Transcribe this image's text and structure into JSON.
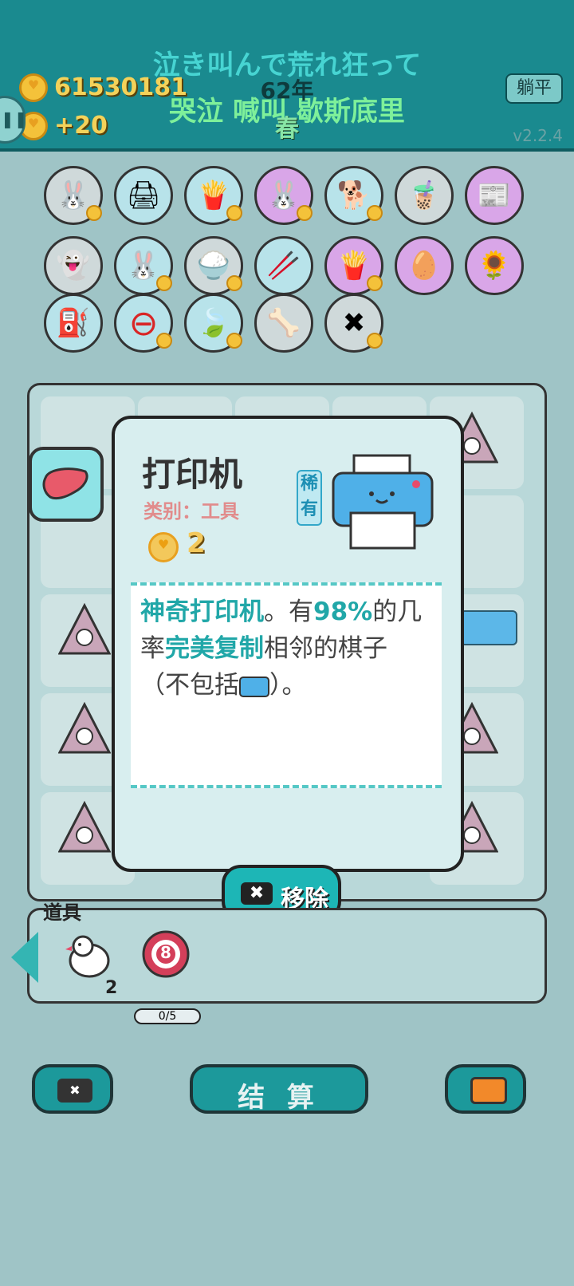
{
  "header": {
    "lyric_jp": "泣き叫んで荒れ狂って",
    "lyric_cn": "哭泣 喊叫 歇斯底里",
    "gold": "61530181",
    "income": "+20",
    "year": "62年",
    "season": "春",
    "flat_button": "躺平",
    "version": "v2.2.4"
  },
  "items_row1": [
    "rabbit-icon",
    "printer-icon",
    "fries-icon",
    "rabbit-icon",
    "husky-icon",
    "boba-icon",
    "time-magazine-icon"
  ],
  "items_row2": [
    "ghost-icon",
    "rabbit-icon",
    "rice-bowl-icon",
    "chopsticks-icon",
    "fries-icon",
    "egg-icon",
    "sunflower-icon"
  ],
  "items_row3": [
    "pump-icon",
    "minus-icon",
    "leaf-icon",
    "dog-bowl-icon",
    "delete-tag-icon"
  ],
  "modal": {
    "title": "打印机",
    "category": "类别：工具",
    "price": "2",
    "rarity": "稀有",
    "description_parts": [
      "神奇打印机",
      "。有",
      "98%",
      "的几率",
      "完美复制",
      "相邻的棋子（不包括",
      "）。"
    ]
  },
  "remove_button": "移除",
  "tools": {
    "label": "道具",
    "pigeon_count": "2",
    "target_number": "8",
    "target_progress": "0/5"
  },
  "settle_button": "结 算",
  "colors": {
    "primary": "#1a8a8f",
    "accent": "#21a7a8",
    "gold": "#f3c85b"
  }
}
